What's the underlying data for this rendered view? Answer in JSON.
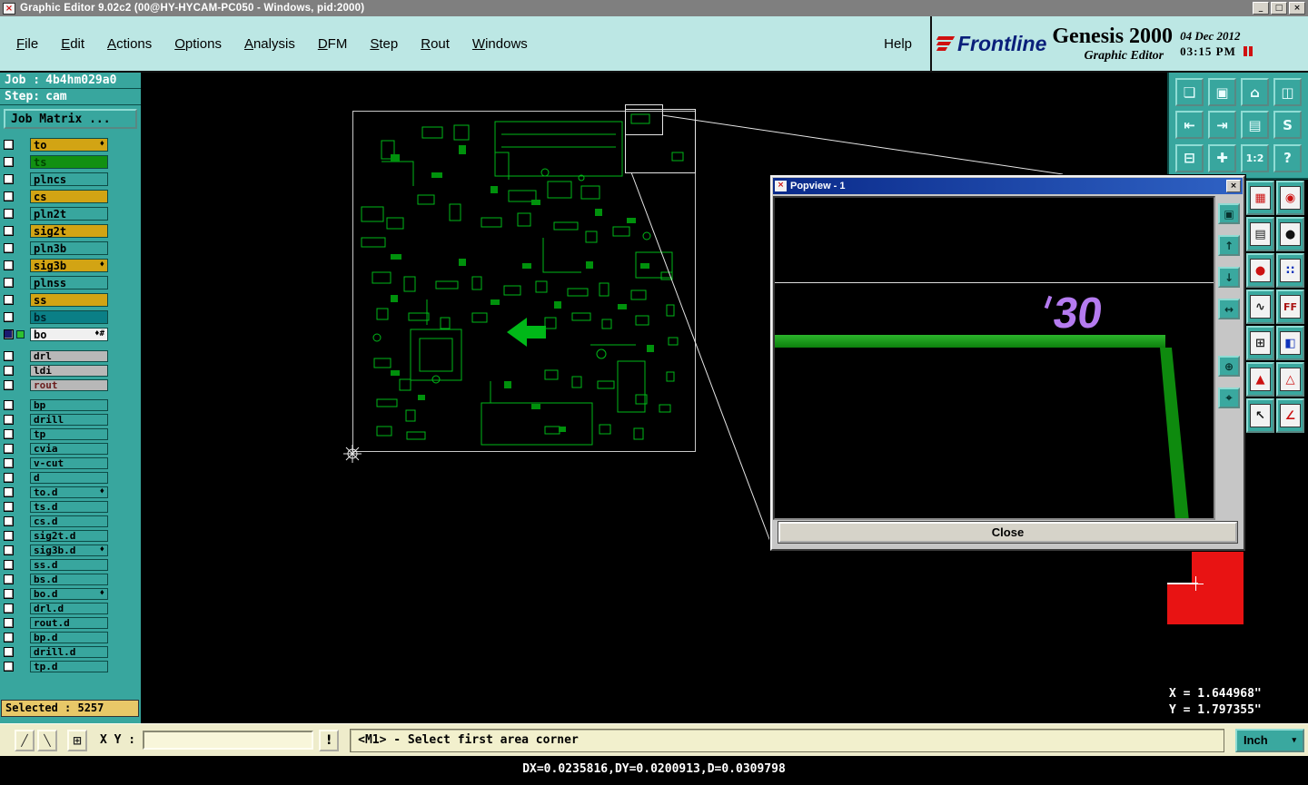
{
  "window": {
    "title": "Graphic Editor 9.02c2 (00@HY-HYCAM-PC050 - Windows, pid:2000)",
    "minimize": "_",
    "maximize": "□",
    "close": "×"
  },
  "menu": {
    "items": [
      "File",
      "Edit",
      "Actions",
      "Options",
      "Analysis",
      "DFM",
      "Step",
      "Rout",
      "Windows"
    ],
    "help": "Help"
  },
  "brand": {
    "logo": "Frontline",
    "product": "Genesis 2000",
    "date": "04 Dec 2012",
    "time": "03:15 PM",
    "subtitle": "Graphic Editor"
  },
  "sidebar": {
    "job_label": "Job :",
    "job_value": "4b4hm029a0",
    "step_label": "Step:",
    "step_value": "cam",
    "matrix_button": "Job Matrix ...",
    "selected_label": "Selected : 5257",
    "layers": [
      {
        "name": "to",
        "bg": "#d2a414",
        "fg": "#000000",
        "group": 1,
        "marker": "♦"
      },
      {
        "name": "ts",
        "bg": "#129012",
        "fg": "#004400",
        "group": 1
      },
      {
        "name": "plncs",
        "bg": "#38a69e",
        "fg": "#000000",
        "group": 1
      },
      {
        "name": "cs",
        "bg": "#d2a414",
        "fg": "#000000",
        "group": 1
      },
      {
        "name": "pln2t",
        "bg": "#38a69e",
        "fg": "#000000",
        "group": 1
      },
      {
        "name": "sig2t",
        "bg": "#d2a414",
        "fg": "#000000",
        "group": 1
      },
      {
        "name": "pln3b",
        "bg": "#38a69e",
        "fg": "#000000",
        "group": 1
      },
      {
        "name": "sig3b",
        "bg": "#d2a414",
        "fg": "#000000",
        "group": 1,
        "marker": "♦"
      },
      {
        "name": "plnss",
        "bg": "#38a69e",
        "fg": "#000000",
        "group": 1
      },
      {
        "name": "ss",
        "bg": "#d2a414",
        "fg": "#000000",
        "group": 1
      },
      {
        "name": "bs",
        "bg": "#0b7f86",
        "fg": "#00222a",
        "group": 1
      },
      {
        "name": "bo",
        "bg": "#f0f0f0",
        "fg": "#000000",
        "group": 1,
        "marker": "♦#",
        "active": true,
        "gap": true
      },
      {
        "name": "drl",
        "bg": "#b8b8b8",
        "fg": "#000000",
        "group": 2
      },
      {
        "name": "ldi",
        "bg": "#b8b8b8",
        "fg": "#000000",
        "group": 2
      },
      {
        "name": "rout",
        "bg": "#b8b8b8",
        "fg": "#6b1d1d",
        "group": 2,
        "gap": true
      },
      {
        "name": "bp",
        "bg": "#38a69e",
        "fg": "#000000",
        "group": 2
      },
      {
        "name": "drill",
        "bg": "#38a69e",
        "fg": "#000000",
        "group": 2
      },
      {
        "name": "tp",
        "bg": "#38a69e",
        "fg": "#000000",
        "group": 2
      },
      {
        "name": "cvia",
        "bg": "#38a69e",
        "fg": "#000000",
        "group": 2
      },
      {
        "name": "v-cut",
        "bg": "#38a69e",
        "fg": "#000000",
        "group": 2
      },
      {
        "name": "d",
        "bg": "#38a69e",
        "fg": "#000000",
        "group": 2
      },
      {
        "name": "to.d",
        "bg": "#38a69e",
        "fg": "#000000",
        "group": 2,
        "marker": "♦"
      },
      {
        "name": "ts.d",
        "bg": "#38a69e",
        "fg": "#000000",
        "group": 2
      },
      {
        "name": "cs.d",
        "bg": "#38a69e",
        "fg": "#000000",
        "group": 2
      },
      {
        "name": "sig2t.d",
        "bg": "#38a69e",
        "fg": "#000000",
        "group": 2
      },
      {
        "name": "sig3b.d",
        "bg": "#38a69e",
        "fg": "#000000",
        "group": 2,
        "marker": "♦"
      },
      {
        "name": "ss.d",
        "bg": "#38a69e",
        "fg": "#000000",
        "group": 2
      },
      {
        "name": "bs.d",
        "bg": "#38a69e",
        "fg": "#000000",
        "group": 2
      },
      {
        "name": "bo.d",
        "bg": "#38a69e",
        "fg": "#000000",
        "group": 2,
        "marker": "♦"
      },
      {
        "name": "drl.d",
        "bg": "#38a69e",
        "fg": "#000000",
        "group": 2
      },
      {
        "name": "rout.d",
        "bg": "#38a69e",
        "fg": "#000000",
        "group": 2
      },
      {
        "name": "bp.d",
        "bg": "#38a69e",
        "fg": "#000000",
        "group": 2
      },
      {
        "name": "drill.d",
        "bg": "#38a69e",
        "fg": "#000000",
        "group": 2
      },
      {
        "name": "tp.d",
        "bg": "#38a69e",
        "fg": "#000000",
        "group": 2
      }
    ]
  },
  "right_toolbar": {
    "buttons": [
      {
        "name": "copy-window-button",
        "glyph": "❏"
      },
      {
        "name": "screen-view-button",
        "glyph": "▣"
      },
      {
        "name": "home-view-button",
        "glyph": "⌂"
      },
      {
        "name": "split-view-button",
        "glyph": "◫"
      },
      {
        "name": "pan-left-button",
        "glyph": "⇤"
      },
      {
        "name": "pan-right-button",
        "glyph": "⇥"
      },
      {
        "name": "layers-view-button",
        "glyph": "▤"
      },
      {
        "name": "s-shape-tool-button",
        "glyph": "S"
      },
      {
        "name": "tile-view-button",
        "glyph": "⊟"
      },
      {
        "name": "crosshair-button",
        "glyph": "✚"
      },
      {
        "name": "zoom-1-2-button",
        "glyph": "1:2"
      },
      {
        "name": "help-tool-button",
        "glyph": "?"
      }
    ]
  },
  "side_toolbar": {
    "buttons": [
      {
        "name": "pad-grid-button",
        "glyph": "▦",
        "color": "#cc1111"
      },
      {
        "name": "net-trace-button",
        "glyph": "◉",
        "color": "#cc1111"
      },
      {
        "name": "ruler-button",
        "glyph": "▤",
        "color": "#222222"
      },
      {
        "name": "dot-feature-button",
        "glyph": "●",
        "color": "#111111"
      },
      {
        "name": "measure-point-button",
        "glyph": "●",
        "color": "#cc1111"
      },
      {
        "name": "point-pair-button",
        "glyph": "∷",
        "color": "#1133bb"
      },
      {
        "name": "curve-tool-button",
        "glyph": "∿",
        "color": "#222222"
      },
      {
        "name": "ff-tool-button",
        "glyph": "FF",
        "color": "#aa1111"
      },
      {
        "name": "grid-plus-button",
        "glyph": "⊞",
        "color": "#222222"
      },
      {
        "name": "shape-fill-button",
        "glyph": "◧",
        "color": "#1133bb"
      },
      {
        "name": "dfm-alert-button",
        "glyph": "▲",
        "color": "#cc1111"
      },
      {
        "name": "dfm-alert-2-button",
        "glyph": "△",
        "color": "#cc1111"
      },
      {
        "name": "pointer-button",
        "glyph": "↖",
        "color": "#111111"
      },
      {
        "name": "angle-measure-button",
        "glyph": "∠",
        "color": "#cc1111"
      }
    ]
  },
  "popview": {
    "title": "Popview - 1",
    "icon": "×",
    "close_icon": "×",
    "close_button": "Close",
    "annotation": "30",
    "tools": [
      {
        "name": "popview-window-button",
        "glyph": "▣"
      },
      {
        "name": "popview-pan-up-button",
        "glyph": "↑"
      },
      {
        "name": "popview-pan-down-button",
        "glyph": "↓"
      },
      {
        "name": "popview-pan-horiz-button",
        "glyph": "↔"
      },
      {
        "name": "popview-zoom-button",
        "glyph": "⊕"
      },
      {
        "name": "popview-center-button",
        "glyph": "⌖"
      }
    ]
  },
  "canvas": {
    "coord_x": "X = 1.644968\"",
    "coord_y": "Y = 1.797355\""
  },
  "statusbar": {
    "left_buttons": [
      {
        "name": "line-snap-button",
        "glyph": "╱"
      },
      {
        "name": "line-snap-2-button",
        "glyph": "╲"
      },
      {
        "name": "grid-toggle-button",
        "glyph": "⊞"
      }
    ],
    "xy_label": "X Y :",
    "xy_value": "",
    "alert_button": "!",
    "message": "<M1> - Select first area corner",
    "units": "Inch",
    "units_arrow": "▾"
  },
  "readout": "DX=0.0235816,DY=0.0200913,D=0.0309798",
  "colors": {
    "teal": "#38a69e",
    "menubar": "#bce7e4",
    "layer_yellow": "#d2a414",
    "layer_green": "#129012",
    "layer_cyan": "#0b7f86",
    "layer_gray": "#b8b8b8",
    "selected_bar": "#e8c868",
    "pcb_green": "#00b818",
    "popview_trace_green": "#16a016",
    "annotation_purple": "#b57bf0",
    "highlight_red": "#e81313",
    "title_blue": "#0a2a8a"
  }
}
